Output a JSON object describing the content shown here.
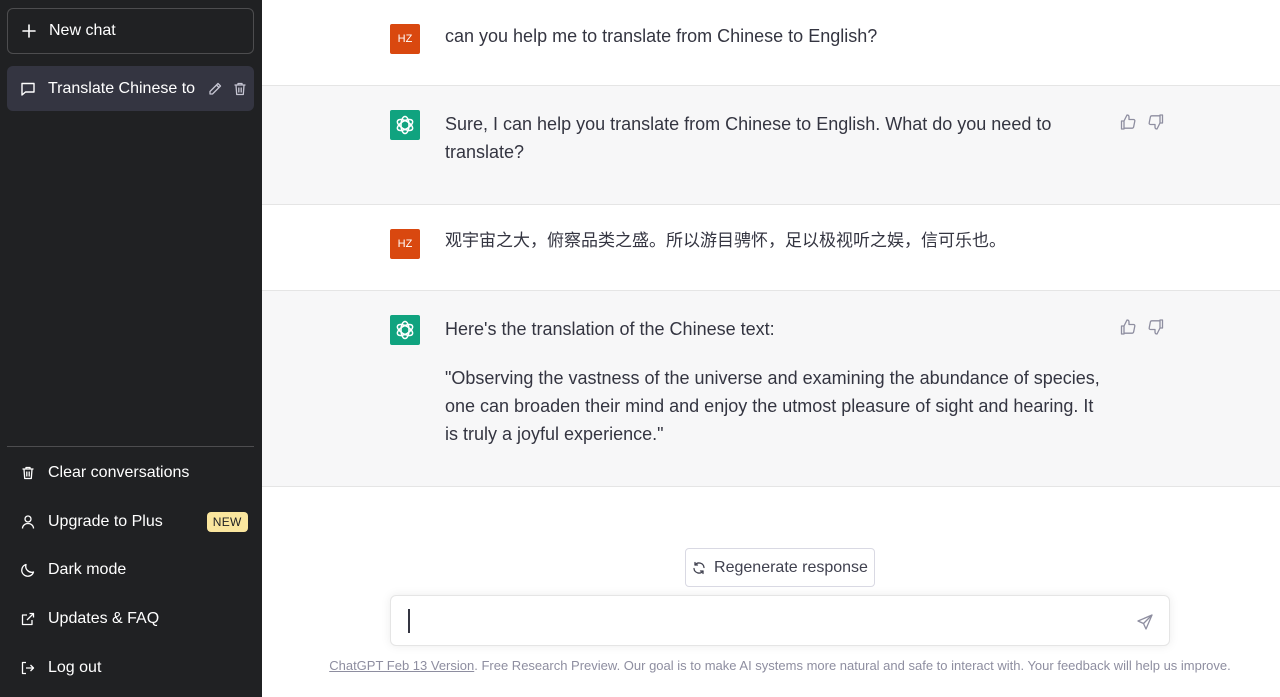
{
  "sidebar": {
    "new_chat": "New chat",
    "conversations": [
      {
        "title": "Translate Chinese to E"
      }
    ],
    "menu": {
      "clear": "Clear conversations",
      "upgrade": "Upgrade to Plus",
      "upgrade_badge": "NEW",
      "dark_mode": "Dark mode",
      "updates": "Updates & FAQ",
      "logout": "Log out"
    }
  },
  "messages": [
    {
      "role": "user",
      "avatar": "HZ",
      "text": "can you help me to translate from Chinese to English?"
    },
    {
      "role": "assistant",
      "paragraphs": [
        "Sure, I can help you translate from Chinese to English. What do you need to translate?"
      ]
    },
    {
      "role": "user",
      "avatar": "HZ",
      "text": "观宇宙之大，俯察品类之盛。所以游目骋怀，足以极视听之娱，信可乐也。"
    },
    {
      "role": "assistant",
      "paragraphs": [
        "Here's the translation of the Chinese text:",
        "\"Observing the vastness of the universe and examining the abundance of species, one can broaden their mind and enjoy the utmost pleasure of sight and hearing. It is truly a joyful experience.\""
      ]
    }
  ],
  "regenerate_label": "Regenerate response",
  "input": {
    "value": "",
    "placeholder": ""
  },
  "footer": {
    "link": "ChatGPT Feb 13 Version",
    "text": ". Free Research Preview. Our goal is to make AI systems more natural and safe to interact with. Your feedback will help us improve."
  },
  "colors": {
    "sidebar_bg": "#202123",
    "user_avatar": "#d9480f",
    "assistant_avatar": "#10a37f",
    "new_badge": "#fae69e"
  }
}
